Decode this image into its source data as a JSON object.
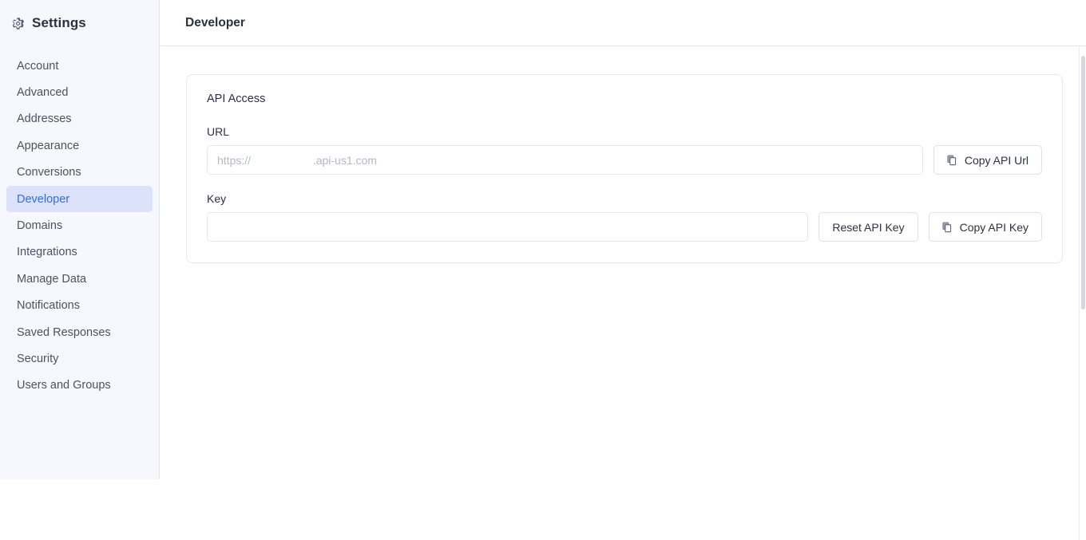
{
  "sidebar": {
    "title": "Settings",
    "gear_icon": "gear-icon",
    "items": [
      {
        "label": "Account",
        "active": false
      },
      {
        "label": "Advanced",
        "active": false
      },
      {
        "label": "Addresses",
        "active": false
      },
      {
        "label": "Appearance",
        "active": false
      },
      {
        "label": "Conversions",
        "active": false
      },
      {
        "label": "Developer",
        "active": true
      },
      {
        "label": "Domains",
        "active": false
      },
      {
        "label": "Integrations",
        "active": false
      },
      {
        "label": "Manage Data",
        "active": false
      },
      {
        "label": "Notifications",
        "active": false
      },
      {
        "label": "Saved Responses",
        "active": false
      },
      {
        "label": "Security",
        "active": false
      },
      {
        "label": "Users and Groups",
        "active": false
      }
    ]
  },
  "header": {
    "title": "Developer"
  },
  "card": {
    "title": "API Access",
    "url_field": {
      "label": "URL",
      "value": "",
      "placeholder": "https://                    .api-us1.com"
    },
    "copy_url_button": {
      "label": "Copy API Url",
      "icon": "copy-icon"
    },
    "key_field": {
      "label": "Key",
      "value": "",
      "placeholder": ""
    },
    "reset_key_button": {
      "label": "Reset API Key"
    },
    "copy_key_button": {
      "label": "Copy API Key",
      "icon": "copy-icon"
    }
  },
  "colors": {
    "sidebar_bg": "#f6f8fd",
    "active_item_bg": "#dde2fb",
    "active_item_text": "#2f6cf6",
    "border": "#e6e8ed",
    "text": "#2c3140",
    "muted_text": "#4c5261",
    "placeholder": "#b3b8c4"
  }
}
